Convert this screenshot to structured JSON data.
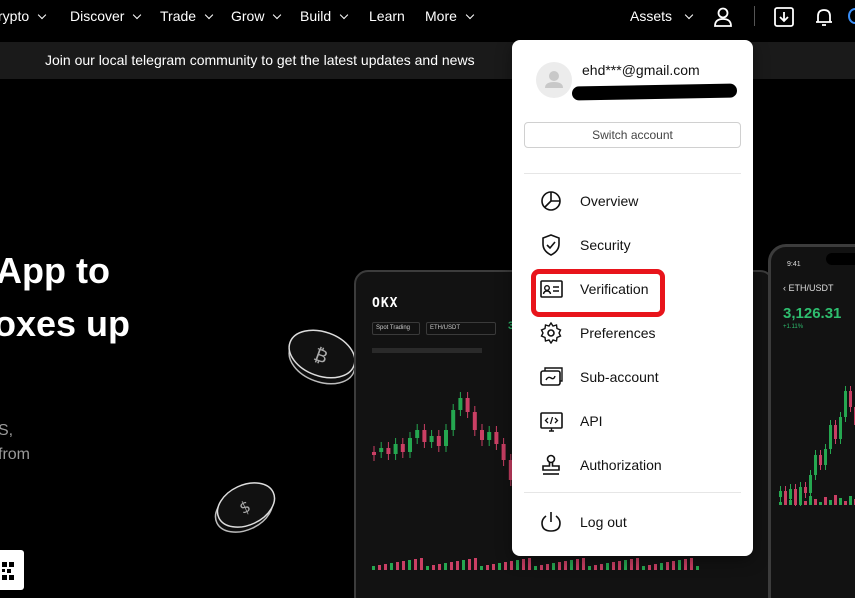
{
  "nav": {
    "items": [
      {
        "label": "rypto",
        "name": "nav-crypto"
      },
      {
        "label": "Discover",
        "name": "nav-discover"
      },
      {
        "label": "Trade",
        "name": "nav-trade"
      },
      {
        "label": "Grow",
        "name": "nav-grow"
      },
      {
        "label": "Build",
        "name": "nav-build"
      },
      {
        "label": "Learn",
        "name": "nav-learn"
      },
      {
        "label": "More",
        "name": "nav-more"
      }
    ],
    "assets_label": "Assets",
    "icons": [
      "user-icon",
      "download-icon",
      "bell-icon"
    ]
  },
  "banner": {
    "text": "Join our local telegram community to get the latest updates and news"
  },
  "hero": {
    "line1": "App to",
    "line2": "oxes up",
    "sub1": "S,",
    "sub2": "from"
  },
  "devices": {
    "tablet": {
      "logo": "OKX",
      "select1": "Spot Trading",
      "select2": "ETH/USDT",
      "price_prefix": "3"
    },
    "phone": {
      "time": "9:41",
      "pair": "ETH/USDT",
      "price": "3,126.31",
      "change": "+1.11%"
    }
  },
  "account_menu": {
    "email": "ehd***@gmail.com",
    "switch_label": "Switch account",
    "items": [
      {
        "label": "Overview",
        "icon": "pie-chart-icon"
      },
      {
        "label": "Security",
        "icon": "shield-check-icon"
      },
      {
        "label": "Verification",
        "icon": "id-card-icon"
      },
      {
        "label": "Preferences",
        "icon": "gear-icon"
      },
      {
        "label": "Sub-account",
        "icon": "sub-account-icon"
      },
      {
        "label": "API",
        "icon": "api-icon"
      },
      {
        "label": "Authorization",
        "icon": "stamp-icon"
      }
    ],
    "logout_label": "Log out",
    "highlight_color": "#e8141b"
  },
  "colors": {
    "candle_up": "#25a750",
    "candle_down": "#ca3f64",
    "accent_green": "#2ebd6e"
  }
}
